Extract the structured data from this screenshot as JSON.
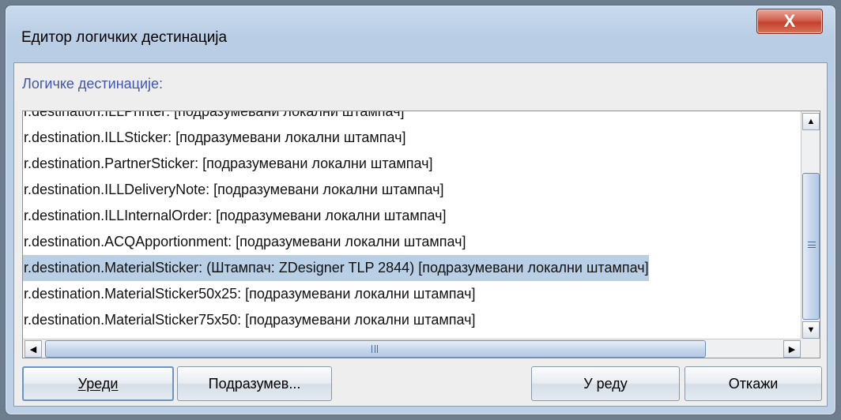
{
  "window": {
    "title": "Едитор логичких дестинација",
    "close_glyph": "X"
  },
  "section": {
    "label": "Логичке дестинације:"
  },
  "list": {
    "items": [
      "r.destination.ILLPrinter: [подразумевани локални штампач]",
      "r.destination.ILLSticker: [подразумевани локални штампач]",
      "r.destination.PartnerSticker: [подразумевани локални штампач]",
      "r.destination.ILLDeliveryNote: [подразумевани локални штампач]",
      "r.destination.ILLInternalOrder: [подразумевани локални штампач]",
      "r.destination.ACQApportionment: [подразумевани локални штампач]",
      "r.destination.MaterialSticker: (Штампач: ZDesigner TLP 2844) [подразумевани локални штампач]",
      "r.destination.MaterialSticker50x25: [подразумевани локални штампач]",
      "r.destination.MaterialSticker75x50: [подразумевани локални штампач]"
    ],
    "selected_index": 6
  },
  "scrollbars": {
    "up_glyph": "▲",
    "down_glyph": "▼",
    "left_glyph": "◀",
    "right_glyph": "▶"
  },
  "buttons": {
    "edit": "Уреди",
    "default": "Подразумев...",
    "ok": "У реду",
    "cancel": "Откажи"
  },
  "colors": {
    "selection": "#b8cfe5",
    "label_blue": "#4057a6",
    "close_red": "#c4412c"
  }
}
